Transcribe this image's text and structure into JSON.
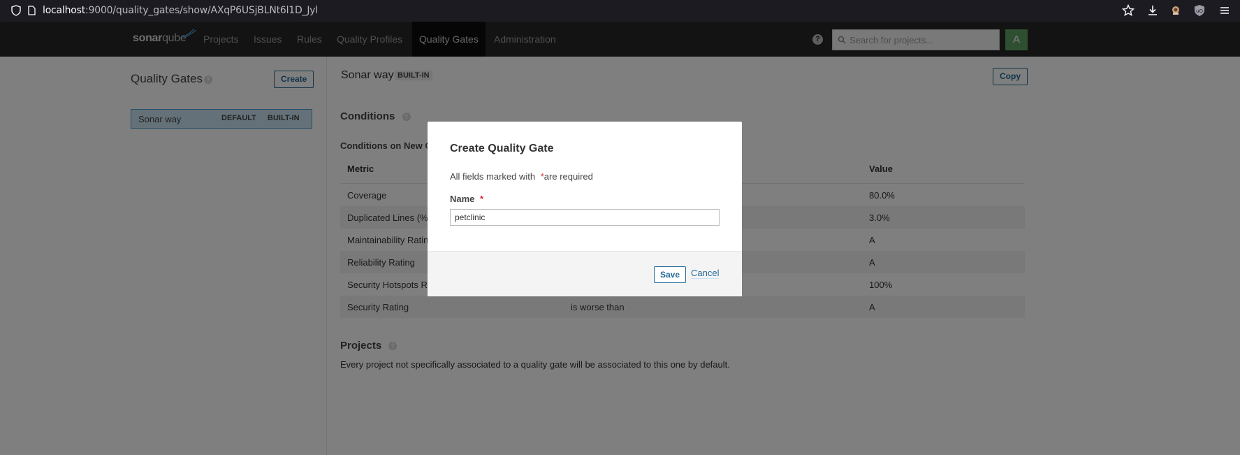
{
  "browser": {
    "url_host": "localhost",
    "url_path": ":9000/quality_gates/show/AXqP6USjBLNt6l1D_Jyl"
  },
  "nav": {
    "logo_bold": "sonar",
    "logo_light": "qube",
    "items": [
      "Projects",
      "Issues",
      "Rules",
      "Quality Profiles",
      "Quality Gates",
      "Administration"
    ],
    "active": "Quality Gates",
    "search_placeholder": "Search for projects...",
    "avatar_letter": "A"
  },
  "sidebar": {
    "title": "Quality Gates",
    "create_label": "Create",
    "gates": [
      {
        "name": "Sonar way",
        "badges": [
          "DEFAULT",
          "BUILT-IN"
        ]
      }
    ]
  },
  "main": {
    "title": "Sonar way",
    "badge": "BUILT-IN",
    "copy_label": "Copy",
    "conditions_title": "Conditions",
    "conditions_subtitle": "Conditions on New C",
    "table_headers": {
      "metric": "Metric",
      "operator": "",
      "value": "Value"
    },
    "rows": [
      {
        "metric": "Coverage",
        "operator": "",
        "value": "80.0%"
      },
      {
        "metric": "Duplicated Lines (%",
        "operator": "",
        "value": "3.0%"
      },
      {
        "metric": "Maintainability Ratin",
        "operator": "",
        "value": "A"
      },
      {
        "metric": "Reliability Rating",
        "operator": "",
        "value": "A"
      },
      {
        "metric": "Security Hotspots R",
        "operator": "",
        "value": "100%"
      },
      {
        "metric": "Security Rating",
        "operator": "is worse than",
        "value": "A"
      }
    ],
    "projects_title": "Projects",
    "projects_text": "Every project not specifically associated to a quality gate will be associated to this one by default."
  },
  "modal": {
    "title": "Create Quality Gate",
    "required_note_pre": "All fields marked with",
    "required_star": "*",
    "required_note_post": "are required",
    "name_label": "Name",
    "name_value": "petclinic",
    "save_label": "Save",
    "cancel_label": "Cancel"
  },
  "colors": {
    "accent": "#236a97",
    "nav_bg": "#262626",
    "selected_bg": "#cae3f2",
    "required": "#d02f3a",
    "avatar": "#5e9e63"
  }
}
